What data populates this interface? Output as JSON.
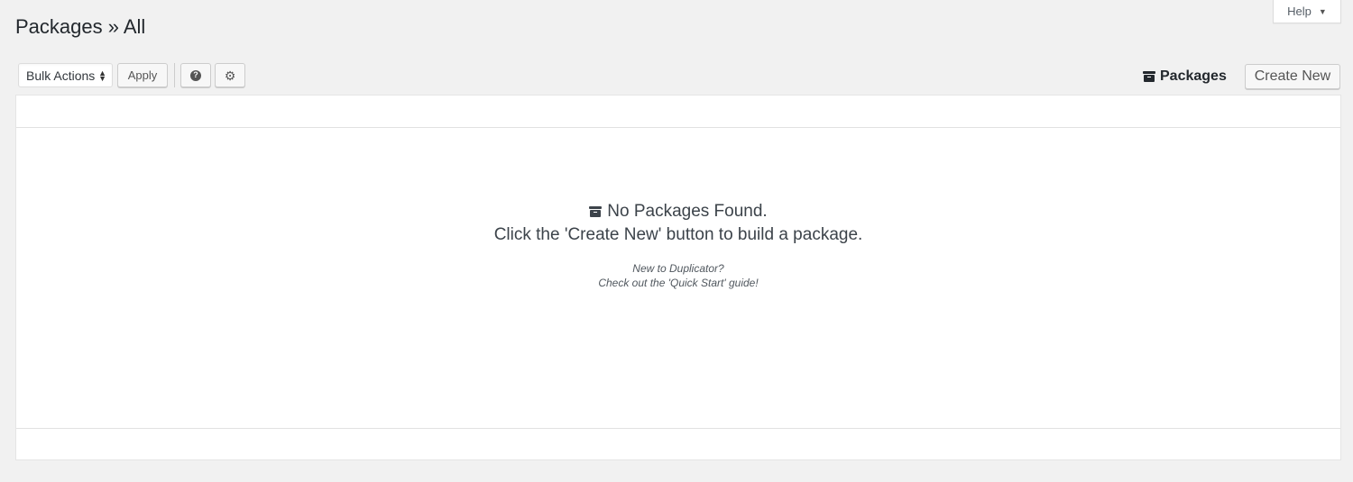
{
  "help_tab": {
    "label": "Help",
    "caret": "▼"
  },
  "title": "Packages » All",
  "toolbar": {
    "bulk_actions": "Bulk Actions",
    "apply": "Apply",
    "help_icon": "question-circle-icon",
    "settings_icon": "gear-icon"
  },
  "header_right": {
    "packages_label": "Packages",
    "packages_icon": "archive-icon",
    "create_new": "Create New"
  },
  "empty_state": {
    "heading": "No Packages Found.",
    "message": "Click the 'Create New' button to build a package.",
    "note_line1": "New to Duplicator?",
    "note_line2": "Check out the 'Quick Start' guide!"
  }
}
